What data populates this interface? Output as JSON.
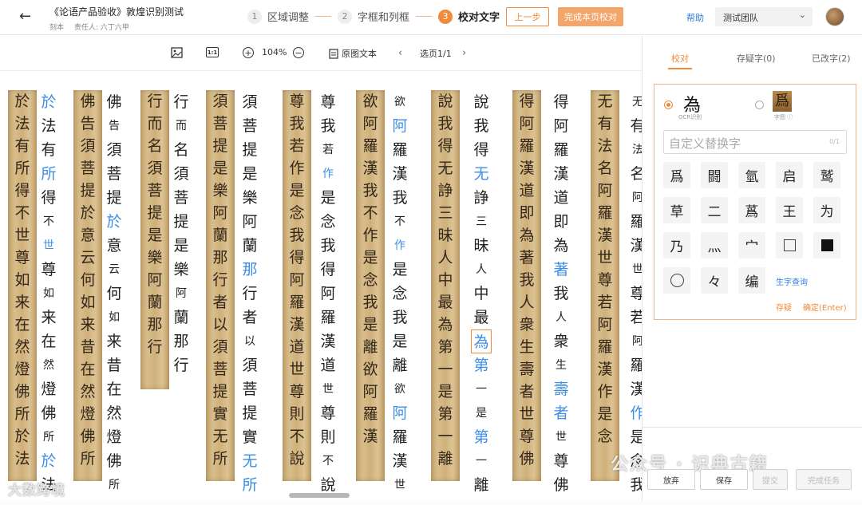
{
  "header": {
    "back_icon": "←",
    "title": "《论语产品验收》敦煌识别测试",
    "meta_type": "刻本",
    "meta_owner": "责任人: 六丁六甲",
    "steps": [
      {
        "num": "1",
        "label": "区域调整"
      },
      {
        "num": "2",
        "label": "字框和列框"
      },
      {
        "num": "3",
        "label": "校对文字"
      }
    ],
    "prev_label": "上一步",
    "done_label": "完成本页校对",
    "help_label": "帮助",
    "team_label": "测试团队"
  },
  "toolbar": {
    "image_icon": "image-icon",
    "zoom_level": "104%",
    "original_text_label": "原图文本",
    "page_label": "选页1/1"
  },
  "manuscript": {
    "strips": [
      {
        "chars": "於法有所得不世尊如来在然燈佛所於法"
      },
      {
        "chars": "佛告須菩提於意云何如来昔在然燈佛所"
      },
      {
        "chars": "行而名須菩提是樂阿蘭那行"
      },
      {
        "chars": "須菩提是樂阿蘭那行者以須菩提實无所"
      },
      {
        "chars": "尊我若作是念我得阿羅漢道世尊則不說"
      },
      {
        "chars": "欲阿羅漢我不作是念我是離欲阿羅漢"
      },
      {
        "chars": "說我得无諍三昧人中最為第一是第一離"
      },
      {
        "chars": "得阿羅漢道即為著我人衆生壽者世尊佛"
      },
      {
        "chars": "无有法名阿羅漢世尊若阿羅漢作是念"
      }
    ],
    "columns": [
      {
        "chars": [
          {
            "t": "於",
            "b": 1
          },
          {
            "t": "法"
          },
          {
            "t": "有"
          },
          {
            "t": "所",
            "b": 1
          },
          {
            "t": "得"
          },
          {
            "t": "不",
            "s": 1
          },
          {
            "t": "世",
            "s": 1,
            "b": 1
          },
          {
            "t": "尊"
          },
          {
            "t": "如",
            "s": 1
          },
          {
            "t": "来"
          },
          {
            "t": "在"
          },
          {
            "t": "然",
            "s": 1
          },
          {
            "t": "燈"
          },
          {
            "t": "佛"
          },
          {
            "t": "所",
            "s": 1
          },
          {
            "t": "於",
            "b": 1
          },
          {
            "t": "法"
          }
        ]
      },
      {
        "chars": [
          {
            "t": "佛"
          },
          {
            "t": "告",
            "s": 1
          },
          {
            "t": "須"
          },
          {
            "t": "菩"
          },
          {
            "t": "提"
          },
          {
            "t": "於",
            "b": 1
          },
          {
            "t": "意"
          },
          {
            "t": "云",
            "s": 1
          },
          {
            "t": "何"
          },
          {
            "t": "如",
            "s": 1
          },
          {
            "t": "来"
          },
          {
            "t": "昔"
          },
          {
            "t": "在"
          },
          {
            "t": "然"
          },
          {
            "t": "燈"
          },
          {
            "t": "佛"
          },
          {
            "t": "所",
            "s": 1
          }
        ]
      },
      {
        "chars": [
          {
            "t": "行"
          },
          {
            "t": "而",
            "s": 1
          },
          {
            "t": "名"
          },
          {
            "t": "須"
          },
          {
            "t": "菩"
          },
          {
            "t": "提"
          },
          {
            "t": "是"
          },
          {
            "t": "樂"
          },
          {
            "t": "阿",
            "s": 1
          },
          {
            "t": "蘭"
          },
          {
            "t": "那"
          },
          {
            "t": "行"
          }
        ]
      },
      {
        "chars": [
          {
            "t": "須"
          },
          {
            "t": "菩"
          },
          {
            "t": "提"
          },
          {
            "t": "是"
          },
          {
            "t": "樂"
          },
          {
            "t": "阿"
          },
          {
            "t": "蘭"
          },
          {
            "t": "那",
            "b": 1
          },
          {
            "t": "行"
          },
          {
            "t": "者"
          },
          {
            "t": "以",
            "s": 1
          },
          {
            "t": "須"
          },
          {
            "t": "菩"
          },
          {
            "t": "提"
          },
          {
            "t": "實"
          },
          {
            "t": "无",
            "b": 1
          },
          {
            "t": "所",
            "b": 1
          }
        ]
      },
      {
        "chars": [
          {
            "t": "尊"
          },
          {
            "t": "我"
          },
          {
            "t": "若",
            "s": 1
          },
          {
            "t": "作",
            "s": 1,
            "b": 1
          },
          {
            "t": "是"
          },
          {
            "t": "念"
          },
          {
            "t": "我"
          },
          {
            "t": "得"
          },
          {
            "t": "阿"
          },
          {
            "t": "羅"
          },
          {
            "t": "漢"
          },
          {
            "t": "道"
          },
          {
            "t": "世",
            "s": 1
          },
          {
            "t": "尊"
          },
          {
            "t": "則"
          },
          {
            "t": "不",
            "s": 1
          },
          {
            "t": "說"
          }
        ]
      },
      {
        "chars": [
          {
            "t": "欲",
            "s": 1
          },
          {
            "t": "阿",
            "b": 1
          },
          {
            "t": "羅"
          },
          {
            "t": "漢"
          },
          {
            "t": "我"
          },
          {
            "t": "不",
            "s": 1
          },
          {
            "t": "作",
            "s": 1,
            "b": 1
          },
          {
            "t": "是"
          },
          {
            "t": "念"
          },
          {
            "t": "我"
          },
          {
            "t": "是"
          },
          {
            "t": "離"
          },
          {
            "t": "欲",
            "s": 1
          },
          {
            "t": "阿",
            "b": 1
          },
          {
            "t": "羅"
          },
          {
            "t": "漢"
          },
          {
            "t": "世",
            "s": 1
          }
        ]
      },
      {
        "chars": [
          {
            "t": "說"
          },
          {
            "t": "我"
          },
          {
            "t": "得"
          },
          {
            "t": "无",
            "b": 1
          },
          {
            "t": "諍"
          },
          {
            "t": "三",
            "s": 1
          },
          {
            "t": "昧"
          },
          {
            "t": "人",
            "s": 1
          },
          {
            "t": "中"
          },
          {
            "t": "最"
          },
          {
            "t": "為",
            "hl": 1
          },
          {
            "t": "第",
            "b": 1
          },
          {
            "t": "一",
            "s": 1
          },
          {
            "t": "是",
            "s": 1
          },
          {
            "t": "第",
            "b": 1
          },
          {
            "t": "一",
            "s": 1
          },
          {
            "t": "離"
          }
        ]
      },
      {
        "chars": [
          {
            "t": "得"
          },
          {
            "t": "阿"
          },
          {
            "t": "羅"
          },
          {
            "t": "漢"
          },
          {
            "t": "道"
          },
          {
            "t": "即"
          },
          {
            "t": "為"
          },
          {
            "t": "著",
            "b": 1
          },
          {
            "t": "我"
          },
          {
            "t": "人",
            "s": 1
          },
          {
            "t": "衆"
          },
          {
            "t": "生",
            "s": 1
          },
          {
            "t": "壽",
            "b": 1
          },
          {
            "t": "者",
            "b": 1
          },
          {
            "t": "世",
            "s": 1
          },
          {
            "t": "尊"
          },
          {
            "t": "佛"
          }
        ]
      },
      {
        "chars": [
          {
            "t": "无",
            "s": 1
          },
          {
            "t": "有"
          },
          {
            "t": "法",
            "s": 1
          },
          {
            "t": "名"
          },
          {
            "t": "阿",
            "s": 1
          },
          {
            "t": "羅"
          },
          {
            "t": "漢"
          },
          {
            "t": "世",
            "s": 1
          },
          {
            "t": "尊"
          },
          {
            "t": "若"
          },
          {
            "t": "阿",
            "s": 1
          },
          {
            "t": "羅"
          },
          {
            "t": "漢"
          },
          {
            "t": "作",
            "b": 1
          },
          {
            "t": "是"
          },
          {
            "t": "念"
          },
          {
            "t": "我"
          }
        ]
      }
    ],
    "watermark_left": "大数跨境"
  },
  "sidebar": {
    "tabs": [
      "校对",
      "存疑字(0)",
      "已改字(2)"
    ],
    "ocr_char": "為",
    "ocr_label": "OCR识别",
    "img_char": "爲",
    "img_label": "字图 ⓘ",
    "custom_placeholder": "自定义替换字",
    "custom_count": "0/1",
    "candidates": [
      "爲",
      "闘",
      "氫",
      "启",
      "鹫",
      "草",
      "二",
      "蔿",
      "宀",
      "□",
      "■",
      "为",
      "乃",
      "灬",
      "〇",
      "々",
      "编"
    ],
    "lookup_label": "生字查询",
    "store_label": "存疑",
    "confirm_label": "确定(Enter)",
    "bottom": {
      "abandon": "放弃",
      "save": "保存",
      "submit": "提交",
      "finish": "完成任务"
    },
    "watermark_right": "公众号 · 识典古籍"
  }
}
